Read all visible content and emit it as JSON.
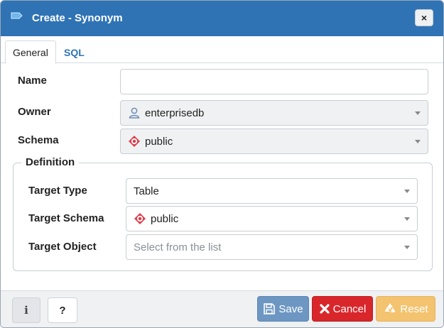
{
  "dialog": {
    "title": "Create - Synonym",
    "close_label": "×"
  },
  "tabs": [
    {
      "label": "General",
      "active": true
    },
    {
      "label": "SQL",
      "active": false
    }
  ],
  "form": {
    "name": {
      "label": "Name",
      "value": ""
    },
    "owner": {
      "label": "Owner",
      "value": "enterprisedb",
      "icon": "user-icon"
    },
    "schema": {
      "label": "Schema",
      "value": "public",
      "icon": "schema-icon"
    }
  },
  "definition": {
    "legend": "Definition",
    "target_type": {
      "label": "Target Type",
      "value": "Table"
    },
    "target_schema": {
      "label": "Target Schema",
      "value": "public",
      "icon": "schema-icon"
    },
    "target_object": {
      "label": "Target Object",
      "placeholder": "Select from the list"
    }
  },
  "footer": {
    "info_label": "i",
    "help_label": "?",
    "save_label": "Save",
    "cancel_label": "Cancel",
    "reset_label": "Reset"
  },
  "colors": {
    "titlebar": "#2f73b5",
    "save": "#6d97c2",
    "cancel": "#d9262b",
    "reset": "#f3c36f",
    "schema_icon": "#d9414d"
  }
}
